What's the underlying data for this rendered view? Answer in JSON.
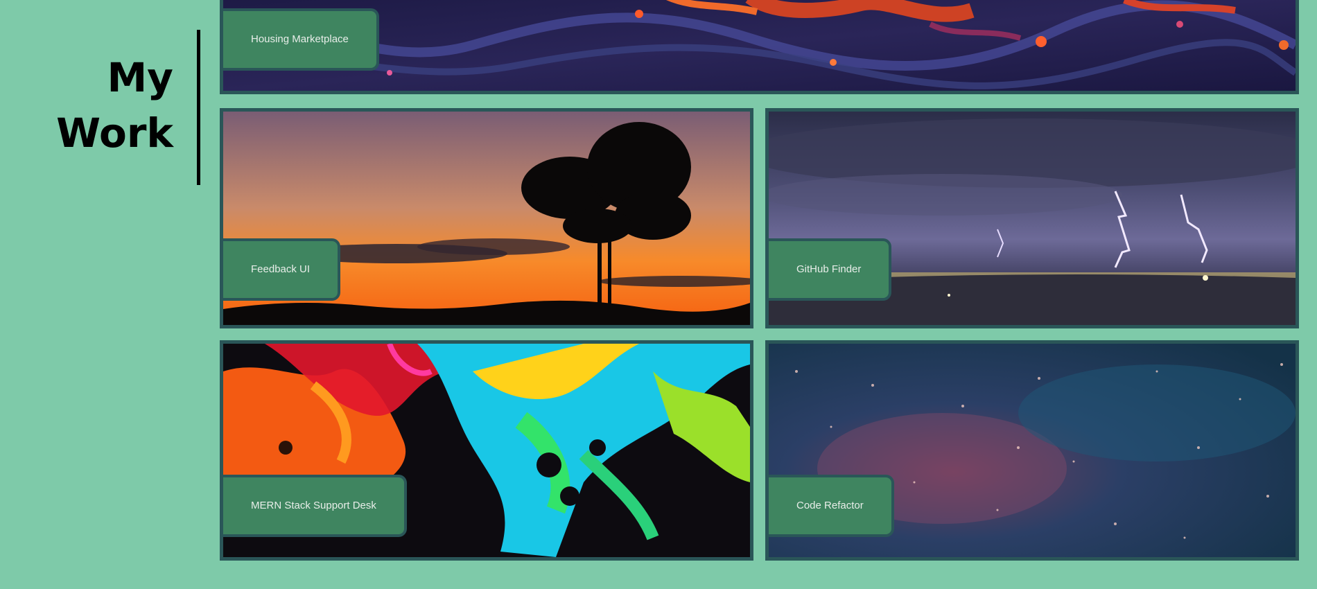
{
  "section": {
    "heading_line1": "My",
    "heading_line2": "Work"
  },
  "projects": [
    {
      "title": "Housing Marketplace",
      "image": "psychedelic-fluid-texture"
    },
    {
      "title": "Feedback UI",
      "image": "sunset-tree-silhouette"
    },
    {
      "title": "GitHub Finder",
      "image": "lightning-storm-over-city"
    },
    {
      "title": "MERN Stack Support Desk",
      "image": "neon-acrylic-pour"
    },
    {
      "title": "Code Refactor",
      "image": "blue-speckled-galaxy"
    }
  ],
  "colors": {
    "background": "#7ecaa9",
    "card_border": "#2a5658",
    "label_background": "#3f8560",
    "label_text": "#e8eee9",
    "heading_text": "#000000"
  }
}
